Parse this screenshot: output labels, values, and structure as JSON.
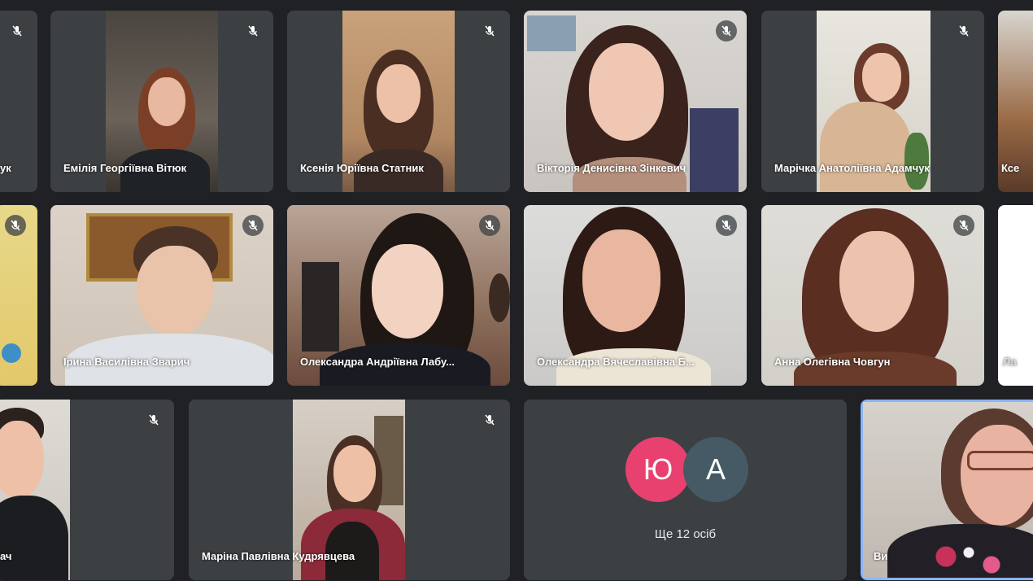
{
  "participants": [
    {
      "name": "ук"
    },
    {
      "name": "Емілія Георгіївна Вітюк"
    },
    {
      "name": "Ксенія Юріївна Статник"
    },
    {
      "name": "Вікторія Денисівна Зінкевич"
    },
    {
      "name": "Марічка Анатоліївна Адамчук"
    },
    {
      "name": "Ксе"
    },
    {
      "name": ""
    },
    {
      "name": "Ірина Василівна Зварич"
    },
    {
      "name": "Олександра Андріївна Лабу..."
    },
    {
      "name": "Олександра Вячеславівна Б..."
    },
    {
      "name": "Анна Олегівна Човгун"
    },
    {
      "name": "Ла"
    },
    {
      "name": "ач"
    },
    {
      "name": "Маріна Павлівна Кудрявцева"
    },
    {
      "name": "Ви"
    }
  ],
  "more_tile": {
    "avatars": [
      {
        "letter": "Ю",
        "color": "#e8416f"
      },
      {
        "letter": "А",
        "color": "#455a64"
      }
    ],
    "label": "Ще 12 осіб"
  },
  "icons": {
    "mute": "mic-off-icon"
  },
  "colors": {
    "background": "#202124",
    "tile": "#3c4043",
    "active_outline": "#8ab4f8"
  }
}
